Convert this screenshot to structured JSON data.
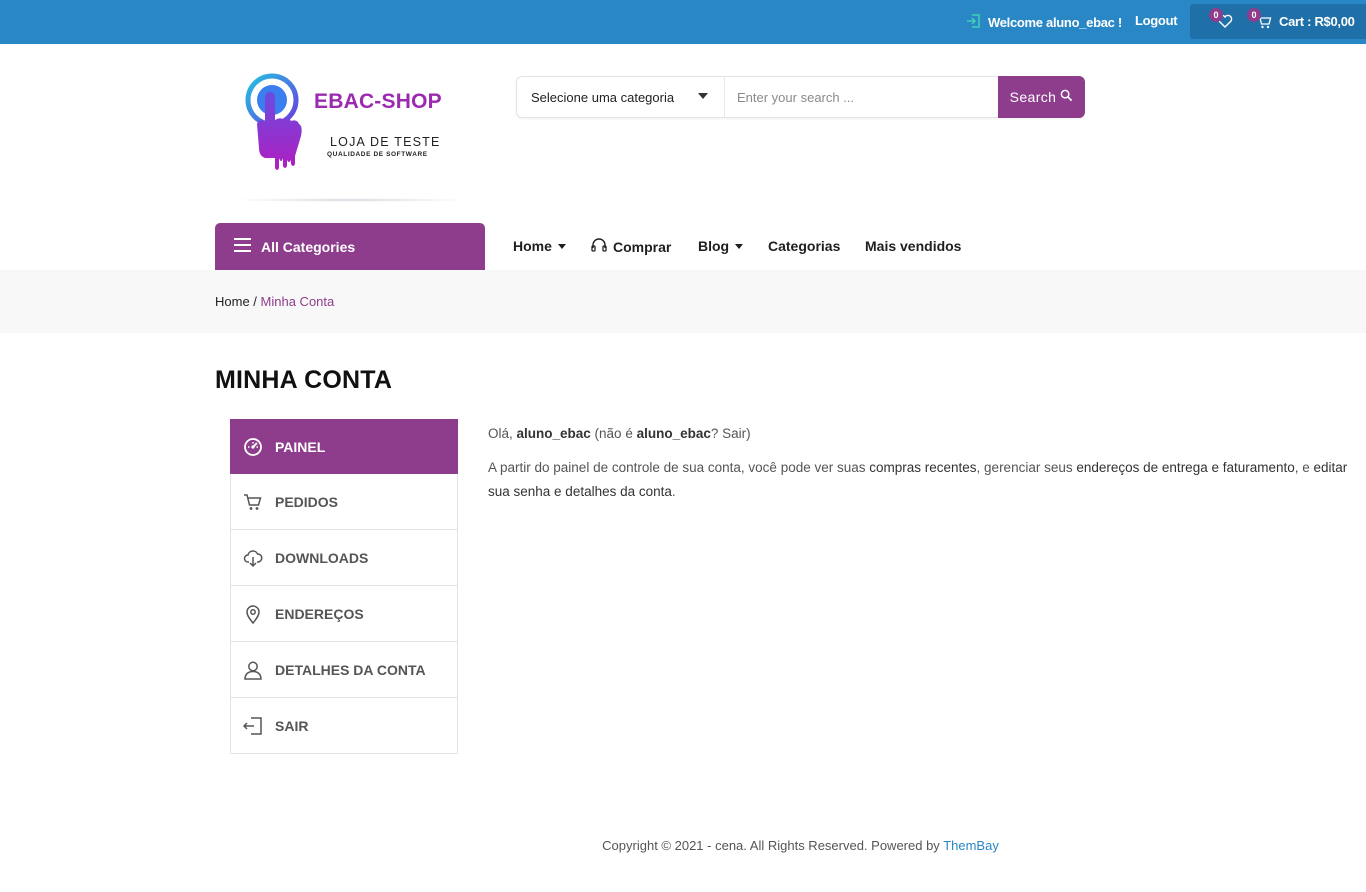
{
  "topbar": {
    "welcome_text": "Welcome aluno_ebac !",
    "logout_label": "Logout",
    "wishlist_count": "0",
    "cart_count": "0",
    "cart_text": "Cart : R$0,00",
    "colors": {
      "bar": "#2a87c6",
      "cart_box": "#1f6fa8",
      "badge": "#8e3d8c"
    }
  },
  "logo": {
    "title": "EBAC-SHOP",
    "subtitle": "LOJA DE TESTE",
    "tagline": "QUALIDADE DE SOFTWARE"
  },
  "search": {
    "category_label": "Selecione uma categoria",
    "placeholder": "Enter your search ...",
    "button_label": "Search"
  },
  "nav": {
    "all_categories": "All Categories",
    "items": [
      {
        "label": "Home",
        "has_dropdown": true
      },
      {
        "label": "Comprar",
        "icon": "headset-icon"
      },
      {
        "label": "Blog",
        "has_dropdown": true
      },
      {
        "label": "Categorias"
      },
      {
        "label": "Mais vendidos"
      }
    ]
  },
  "breadcrumb": {
    "home": "Home",
    "separator": " / ",
    "current": "Minha Conta"
  },
  "page_title": "MINHA CONTA",
  "account_menu": {
    "items": [
      {
        "label": "PAINEL",
        "icon": "dashboard-icon",
        "active": true
      },
      {
        "label": "PEDIDOS",
        "icon": "cart-icon"
      },
      {
        "label": "DOWNLOADS",
        "icon": "cloud-download-icon"
      },
      {
        "label": "ENDEREÇOS",
        "icon": "map-pin-icon"
      },
      {
        "label": "DETALHES DA CONTA",
        "icon": "user-icon"
      },
      {
        "label": "SAIR",
        "icon": "logout-icon"
      }
    ]
  },
  "content": {
    "greeting_prefix": "Olá, ",
    "username": "aluno_ebac",
    "not_prefix": " (não é ",
    "username2": "aluno_ebac",
    "q_mark": "? ",
    "sair_link": "Sair",
    "close_paren": ")",
    "p2_a": "A partir do painel de controle de sua conta, você pode ver suas ",
    "p2_link1": "compras recentes",
    "p2_b": ", gerenciar seus ",
    "p2_link2": "endereços de entrega e faturamento",
    "p2_c": ", e ",
    "p2_link3": "editar sua senha e detalhes da conta",
    "p2_d": "."
  },
  "footer": {
    "text": "Copyright © 2021 - cena. All Rights Reserved. Powered by ",
    "link": "ThemBay"
  },
  "colors": {
    "accent": "#8e3d8c",
    "link_blue": "#2a87c6"
  }
}
